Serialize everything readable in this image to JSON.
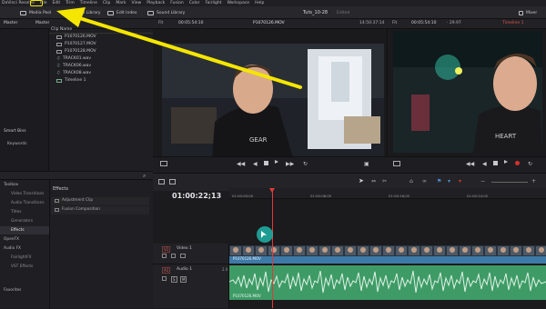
{
  "menubar": {
    "items": [
      "DaVinci Resolve",
      "File",
      "Edit",
      "Trim",
      "Timeline",
      "Clip",
      "Mark",
      "View",
      "Playback",
      "Fusion",
      "Color",
      "Fairlight",
      "Workspace",
      "Help"
    ]
  },
  "toolbar": {
    "media_pool": "Media Pool",
    "effects_library": "Effects Library",
    "edit_index": "Edit Index",
    "sound_library": "Sound Library",
    "project_title": "Tuts_10-28",
    "project_status": "Edited",
    "mixer": "Mixer"
  },
  "viewer_bar": {
    "fit_left": "Fit",
    "timecode_left": "00:05:54:10",
    "clip_name": "P1070126.MOV",
    "source_tc": "14:50:37:14",
    "fit_right": "Fit",
    "timecode_right": "00:05:54:10",
    "fps": "29.97",
    "timeline_name": "Timeline 1"
  },
  "bins": {
    "master": "Master",
    "smart_bins": "Smart Bins",
    "keywords": "Keywords"
  },
  "media_pool": {
    "header_master": "Master",
    "column": "Clip Name",
    "clips": [
      "P1070126.MOV",
      "P1070127.MOV",
      "P1070128.MOV",
      "TRACK01.wav",
      "TRACK06.wav",
      "TRACK08.wav",
      "Timeline 1"
    ]
  },
  "effects_panel": {
    "tree": [
      "Toolbox",
      "Video Transitions",
      "Audio Transitions",
      "Titles",
      "Generators",
      "Effects",
      "OpenFX",
      "Audio FX",
      "FairlightFX",
      "VST Effects"
    ],
    "favorites": "Favorites",
    "header": "Effects",
    "items": [
      "Adjustment Clip",
      "Fusion Composition"
    ]
  },
  "timeline": {
    "timecode": "01:00:22;13",
    "ruler_ticks": [
      "01:00:00;00",
      "01:00:08;00",
      "01:00:16;02",
      "01:00:24;02"
    ],
    "video_track": {
      "id": "V1",
      "name": "Video 1",
      "clip": "P1070126.MOV"
    },
    "audio_track": {
      "id": "A1",
      "name": "Audio 1",
      "level": "2.0",
      "clip": "P1070126.MOV"
    }
  },
  "colors": {
    "accent_yellow": "#f5e600",
    "video_clip": "#3e7aa8",
    "audio_clip": "#3e9b66",
    "playhead": "#e03a3a",
    "cursor_teal": "#1fb3a8"
  }
}
